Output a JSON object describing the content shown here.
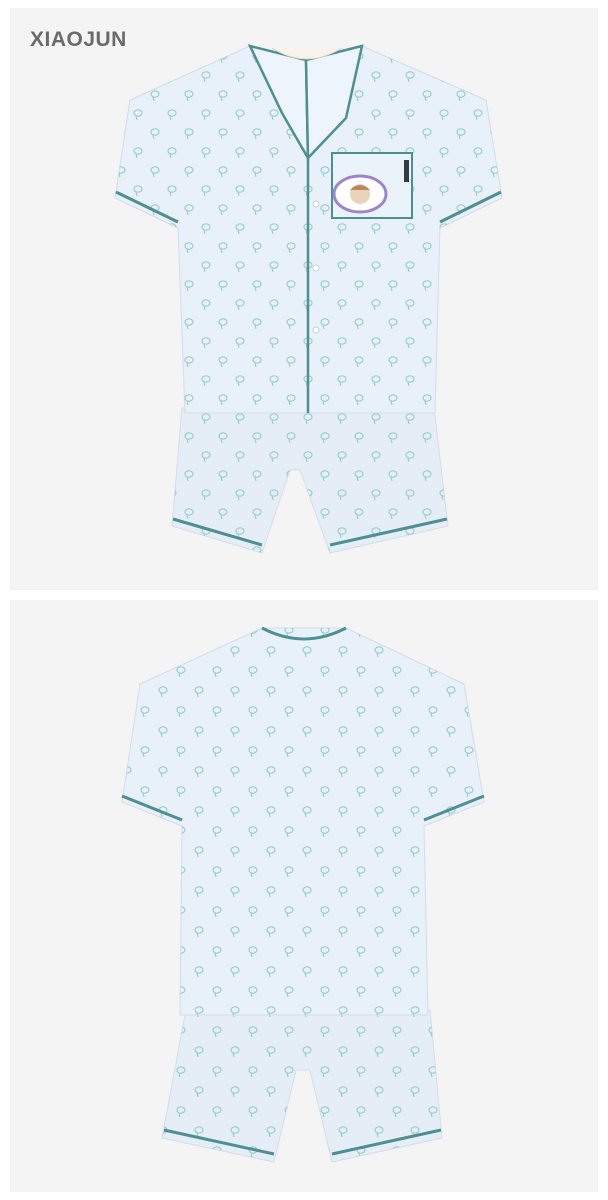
{
  "brand": {
    "name": "XIAOJUN"
  },
  "colors": {
    "panel_background": "#f4f4f4",
    "fabric": "#e6eff8",
    "piping": "#4e8f92",
    "motif": "#7ec3bd",
    "patch_border": "#9a86c8",
    "brand_text": "#6a6a6a"
  },
  "views": [
    {
      "name": "front",
      "garment": "pajama-set-shirt-and-shorts"
    },
    {
      "name": "back",
      "garment": "pajama-set-shirt-and-shorts"
    }
  ]
}
